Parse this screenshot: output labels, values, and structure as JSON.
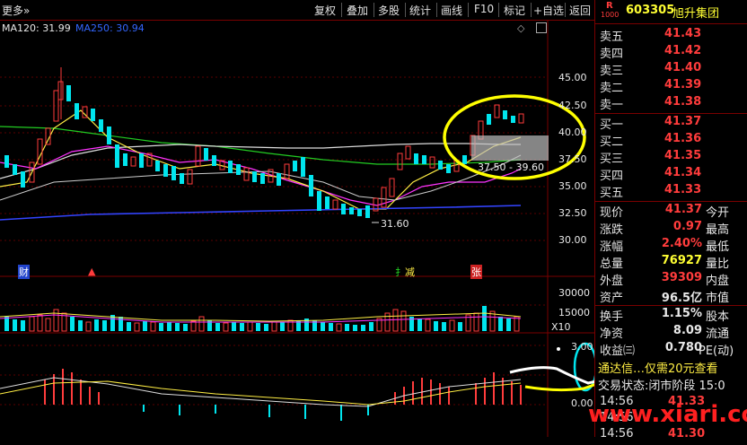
{
  "toolbar": {
    "more_label": "更多",
    "buttons": [
      "复权",
      "叠加",
      "多股",
      "统计",
      "画线",
      "F10",
      "标记",
      "+自选",
      "返回"
    ]
  },
  "stock": {
    "badge_top": "R",
    "badge_bottom": "1000",
    "code": "603305",
    "name": "旭升集团"
  },
  "ma_legend": {
    "ma120": "MA120: 31.99",
    "ma250": "MA250: 30.94"
  },
  "price_axis": [
    "42.50",
    "40.00",
    "37.50",
    "35.00",
    "32.50",
    "30.00",
    "45.00"
  ],
  "low_label": "31.60",
  "range_label": "37.50 - 39.60",
  "event_labels": {
    "cai": "财",
    "jianjian": "减",
    "zhang": "张"
  },
  "volume_axis": [
    "30000",
    "15000",
    "X10"
  ],
  "macd_axis": [
    "3.00",
    "0.00"
  ],
  "orderbook": {
    "asks": [
      {
        "label": "卖五",
        "price": "41.43"
      },
      {
        "label": "卖四",
        "price": "41.42"
      },
      {
        "label": "卖三",
        "price": "41.40"
      },
      {
        "label": "卖二",
        "price": "41.39"
      },
      {
        "label": "卖一",
        "price": "41.38"
      }
    ],
    "bids": [
      {
        "label": "买一",
        "price": "41.37"
      },
      {
        "label": "买二",
        "price": "41.36"
      },
      {
        "label": "买三",
        "price": "41.35"
      },
      {
        "label": "买四",
        "price": "41.34"
      },
      {
        "label": "买五",
        "price": "41.33"
      }
    ]
  },
  "quote": [
    {
      "l1": "现价",
      "v1": "41.37",
      "l2": "今开"
    },
    {
      "l1": "涨跌",
      "v1": "0.97",
      "l2": "最高"
    },
    {
      "l1": "涨幅",
      "v1": "2.40%",
      "l2": "最低"
    },
    {
      "l1": "总量",
      "v1": "76927",
      "l2": "量比"
    },
    {
      "l1": "外盘",
      "v1": "39309",
      "l2": "内盘"
    },
    {
      "l1": "资产",
      "v1": "96.5亿",
      "l2": "市值"
    },
    {
      "l1": "换手",
      "v1": "1.15%",
      "l2": "股本"
    },
    {
      "l1": "净资",
      "v1": "8.09",
      "l2": "流通"
    },
    {
      "l1": "收益㈢",
      "v1": "0.780",
      "l2": "PE(动)"
    }
  ],
  "info_lines": {
    "promo": "通达信…仅需20元查看",
    "status": "交易状态:闭市阶段 15:0"
  },
  "ticks": [
    {
      "time": "14:56",
      "price": "41.33"
    },
    {
      "time": "14:56",
      "price": ""
    },
    {
      "time": "14:56",
      "price": "41.30"
    }
  ],
  "watermark": "www.xiari.com",
  "colors": {
    "up": "#ff3c3c",
    "down": "#00e5ee",
    "accent": "#ffff33",
    "border": "#7a0000"
  }
}
